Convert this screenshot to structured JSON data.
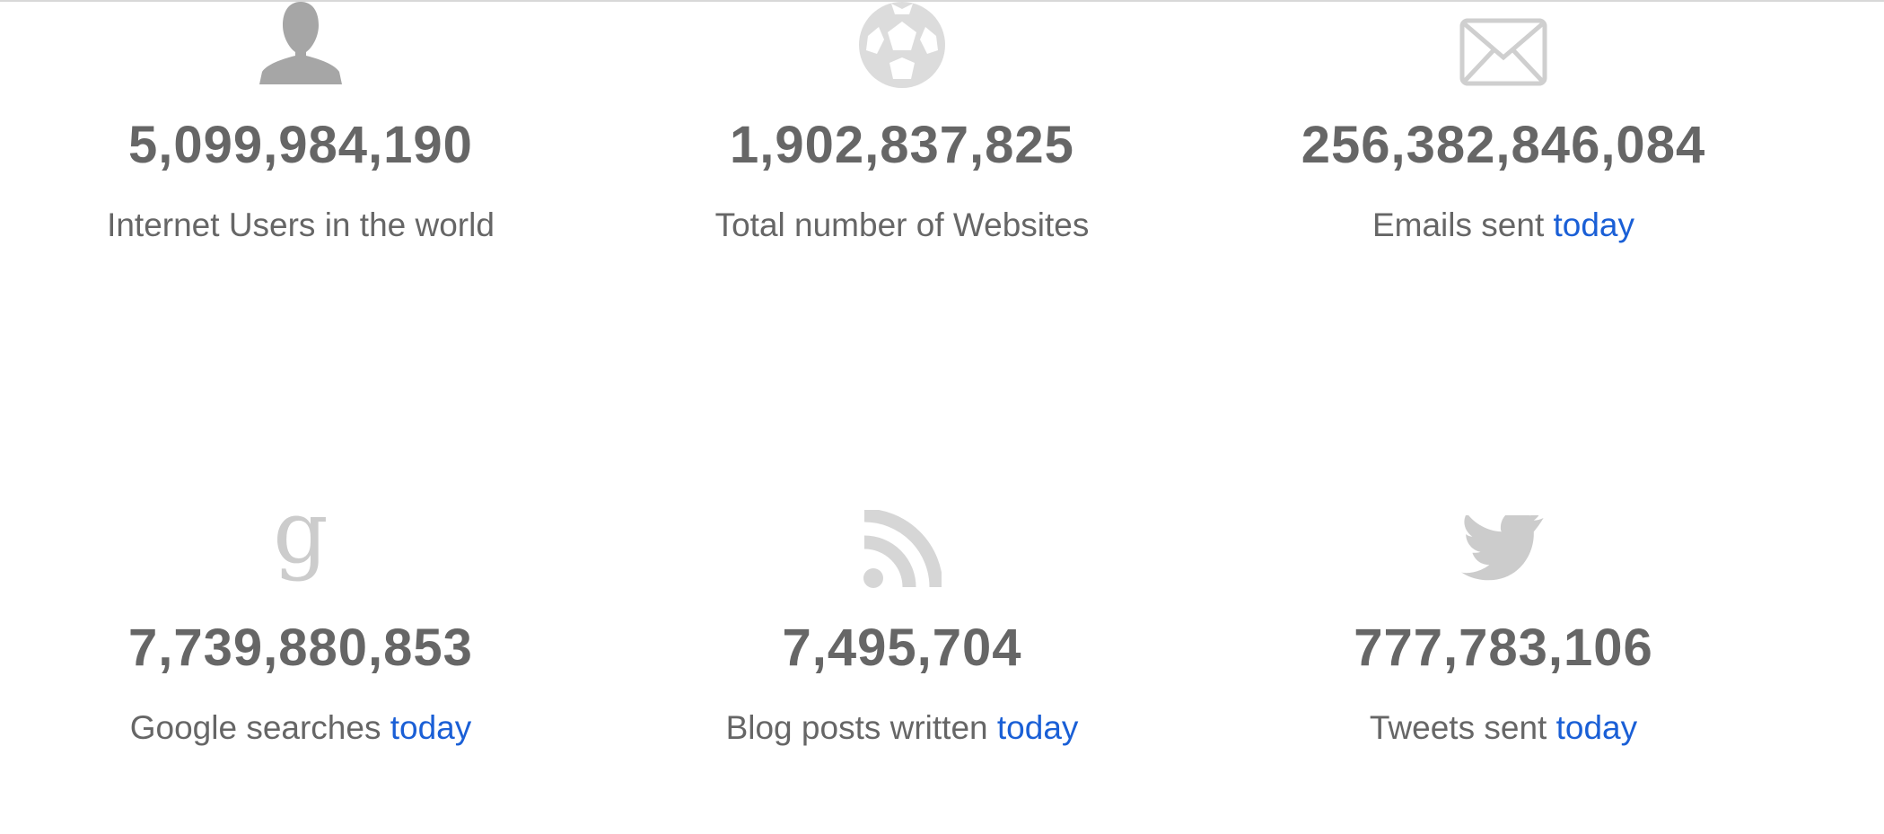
{
  "stats": [
    {
      "icon": "user-icon",
      "count": "5,099,984,190",
      "caption": "Internet Users in the world",
      "link": ""
    },
    {
      "icon": "globe-icon",
      "count": "1,902,837,825",
      "caption": "Total number of Websites",
      "link": ""
    },
    {
      "icon": "envelope-icon",
      "count": "256,382,846,084",
      "caption": "Emails sent",
      "link": "today"
    },
    {
      "icon": "google-icon",
      "count": "7,739,880,853",
      "caption": "Google searches",
      "link": "today"
    },
    {
      "icon": "rss-icon",
      "count": "7,495,704",
      "caption": "Blog posts written",
      "link": "today"
    },
    {
      "icon": "twitter-bird-icon",
      "count": "777,783,106",
      "caption": "Tweets sent",
      "link": "today"
    }
  ],
  "colors": {
    "text": "#666666",
    "link": "#1a5fd6",
    "icon_gray": "#a6a6a6",
    "icon_light": "#d9d9d9"
  }
}
